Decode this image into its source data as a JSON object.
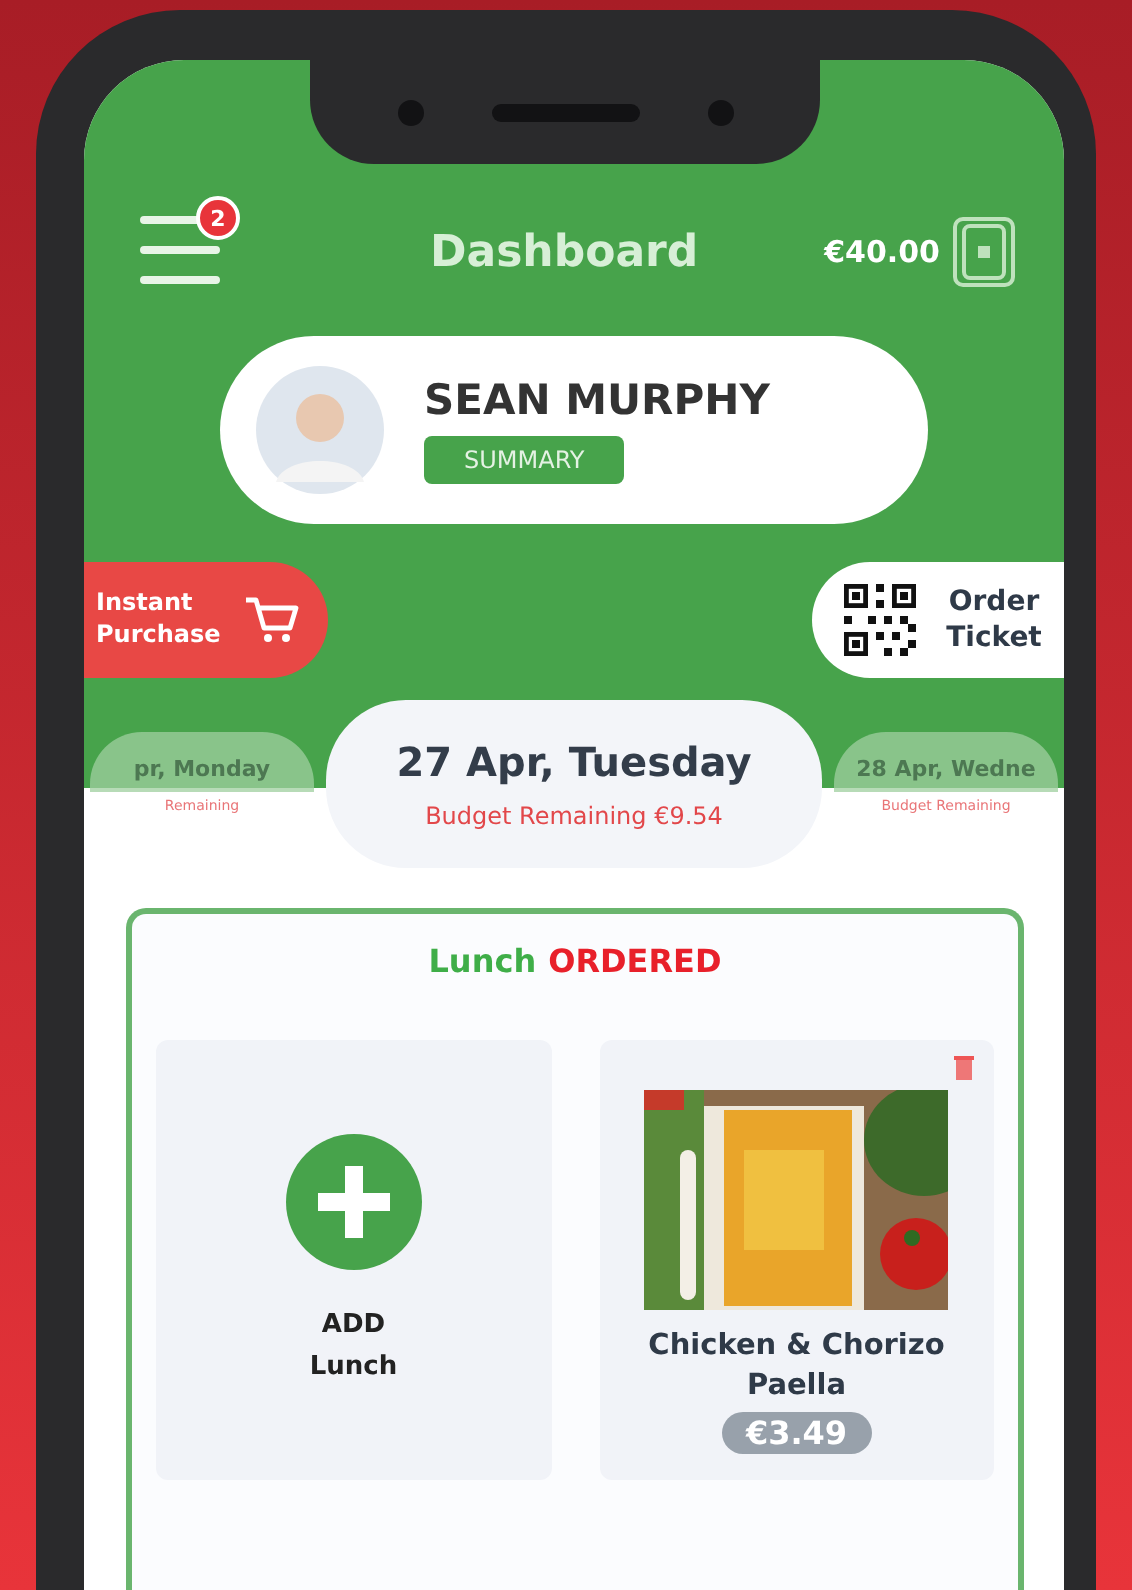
{
  "header": {
    "menu_badge": "2",
    "title": "Dashboard",
    "balance": "€40.00"
  },
  "profile": {
    "name": "SEAN MURPHY",
    "summary_button": "SUMMARY"
  },
  "actions": [
    {
      "kind": "purchase",
      "label": "Instant Purchase"
    },
    {
      "kind": "ticket",
      "label": "Order Ticket"
    }
  ],
  "days": [
    {
      "date": "pr, Monday",
      "budget": "Remaining",
      "selected": false
    },
    {
      "date": "27 Apr, Tuesday",
      "budget": "Budget Remaining €9.54",
      "selected": true
    },
    {
      "date": "28 Apr, Wedne",
      "budget": "Budget Remaining",
      "selected": false
    }
  ],
  "meal": {
    "label": "Lunch",
    "status": "ORDERED",
    "tiles": [
      {
        "kind": "add",
        "label": "ADD Lunch"
      },
      {
        "kind": "item",
        "name": "Chicken & Chorizo Paella",
        "price": "€3.49"
      }
    ]
  }
}
